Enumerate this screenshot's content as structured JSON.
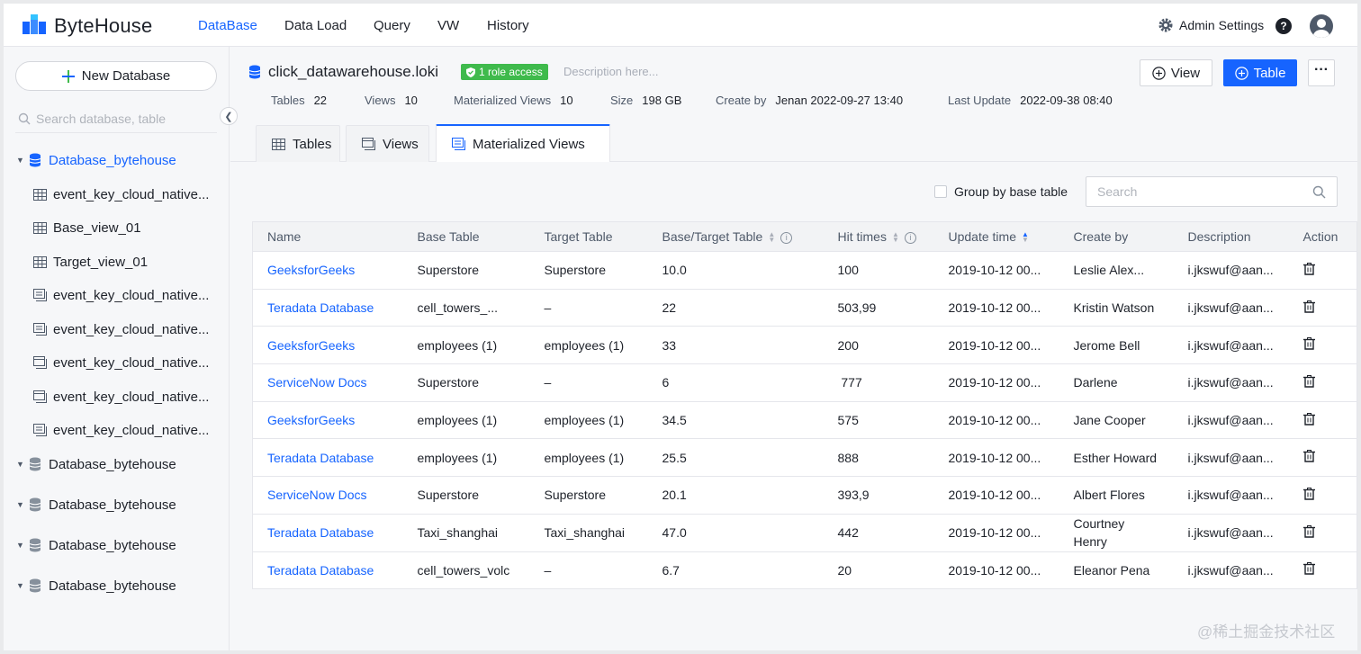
{
  "app": {
    "name": "ByteHouse"
  },
  "nav": {
    "items": [
      {
        "label": "DataBase",
        "active": true
      },
      {
        "label": "Data Load",
        "active": false
      },
      {
        "label": "Query",
        "active": false
      },
      {
        "label": "VW",
        "active": false
      },
      {
        "label": "History",
        "active": false
      }
    ],
    "admin_settings": "Admin Settings"
  },
  "sidebar": {
    "new_database": "New Database",
    "search_placeholder": "Search database, table",
    "tree": [
      {
        "type": "db",
        "label": "Database_bytehouse",
        "active": true,
        "expanded": true
      },
      {
        "type": "table",
        "label": "event_key_cloud_native..."
      },
      {
        "type": "table",
        "label": "Base_view_01"
      },
      {
        "type": "table",
        "label": "Target_view_01"
      },
      {
        "type": "mview",
        "label": "event_key_cloud_native..."
      },
      {
        "type": "mview",
        "label": "event_key_cloud_native..."
      },
      {
        "type": "view",
        "label": "event_key_cloud_native..."
      },
      {
        "type": "view",
        "label": "event_key_cloud_native..."
      },
      {
        "type": "mview",
        "label": "event_key_cloud_native..."
      },
      {
        "type": "db",
        "label": "Database_bytehouse",
        "active": false,
        "expanded": false
      },
      {
        "type": "db",
        "label": "Database_bytehouse",
        "active": false,
        "expanded": false
      },
      {
        "type": "db",
        "label": "Database_bytehouse",
        "active": false,
        "expanded": false
      },
      {
        "type": "db",
        "label": "Database_bytehouse",
        "active": false,
        "expanded": false
      }
    ]
  },
  "header": {
    "db_name": "click_datawarehouse.loki",
    "role_badge": "1 role access",
    "description_placeholder": "Description here...",
    "view_button": "View",
    "table_button": "Table",
    "more": "···",
    "stats": {
      "tables_label": "Tables",
      "tables_value": "22",
      "views_label": "Views",
      "views_value": "10",
      "mviews_label": "Materialized Views",
      "mviews_value": "10",
      "size_label": "Size",
      "size_value": "198 GB",
      "create_label": "Create by",
      "create_value": "Jenan  2022-09-27 13:40",
      "update_label": "Last Update",
      "update_value": "2022-09-38 08:40"
    }
  },
  "tabs": [
    {
      "label": "Tables",
      "active": false
    },
    {
      "label": "Views",
      "active": false
    },
    {
      "label": "Materialized Views",
      "active": true
    }
  ],
  "toolbar": {
    "group_by_label": "Group by base table",
    "search_placeholder": "Search"
  },
  "table": {
    "columns": [
      "Name",
      "Base Table",
      "Target Table",
      "Base/Target Table",
      "Hit times",
      "Update time",
      "Create by",
      "Description",
      "Action"
    ],
    "rows": [
      {
        "name": "GeeksforGeeks",
        "base": "Superstore",
        "target": "Superstore",
        "ratio": "10.0",
        "hits": "100",
        "update": "2019-10-12 00...",
        "creator": "Leslie Alex...",
        "desc": "i.jkswuf@aan..."
      },
      {
        "name": "Teradata Database",
        "base": "cell_towers_...",
        "target": "–",
        "ratio": "22",
        "hits": "503,99",
        "update": "2019-10-12 00...",
        "creator": "Kristin Watson",
        "desc": "i.jkswuf@aan..."
      },
      {
        "name": "GeeksforGeeks",
        "base": "employees (1)",
        "target": "employees (1)",
        "ratio": "33",
        "hits": "200",
        "update": "2019-10-12 00...",
        "creator": "Jerome Bell",
        "desc": "i.jkswuf@aan..."
      },
      {
        "name": "ServiceNow Docs",
        "base": "Superstore",
        "target": "–",
        "ratio": "6",
        "hits": " 777",
        "update": "2019-10-12 00...",
        "creator": "Darlene",
        "desc": "i.jkswuf@aan..."
      },
      {
        "name": "GeeksforGeeks",
        "base": "employees (1)",
        "target": "employees (1)",
        "ratio": "34.5",
        "hits": "575",
        "update": "2019-10-12 00...",
        "creator": "Jane Cooper",
        "desc": "i.jkswuf@aan..."
      },
      {
        "name": "Teradata Database",
        "base": "employees (1)",
        "target": "employees (1)",
        "ratio": "25.5",
        "hits": "888",
        "update": "2019-10-12 00...",
        "creator": "Esther Howard",
        "desc": "i.jkswuf@aan..."
      },
      {
        "name": "ServiceNow Docs",
        "base": "Superstore",
        "target": "Superstore",
        "ratio": "20.1",
        "hits": "393,9",
        "update": "2019-10-12 00...",
        "creator": "Albert Flores",
        "desc": "i.jkswuf@aan..."
      },
      {
        "name": "Teradata Database",
        "base": "Taxi_shanghai",
        "target": "Taxi_shanghai",
        "ratio": "47.0",
        "hits": "442",
        "update": "2019-10-12 00...",
        "creator": "Courtney Henry",
        "desc": "i.jkswuf@aan..."
      },
      {
        "name": "Teradata Database",
        "base": "cell_towers_volc",
        "target": "–",
        "ratio": "6.7",
        "hits": "20",
        "update": "2019-10-12 00...",
        "creator": "Eleanor Pena",
        "desc": "i.jkswuf@aan..."
      }
    ]
  },
  "watermark": "@稀土掘金技术社区",
  "colors": {
    "accent": "#1664ff",
    "badge": "#3fba4c",
    "text": "#1d2129",
    "muted": "#4e5969"
  }
}
